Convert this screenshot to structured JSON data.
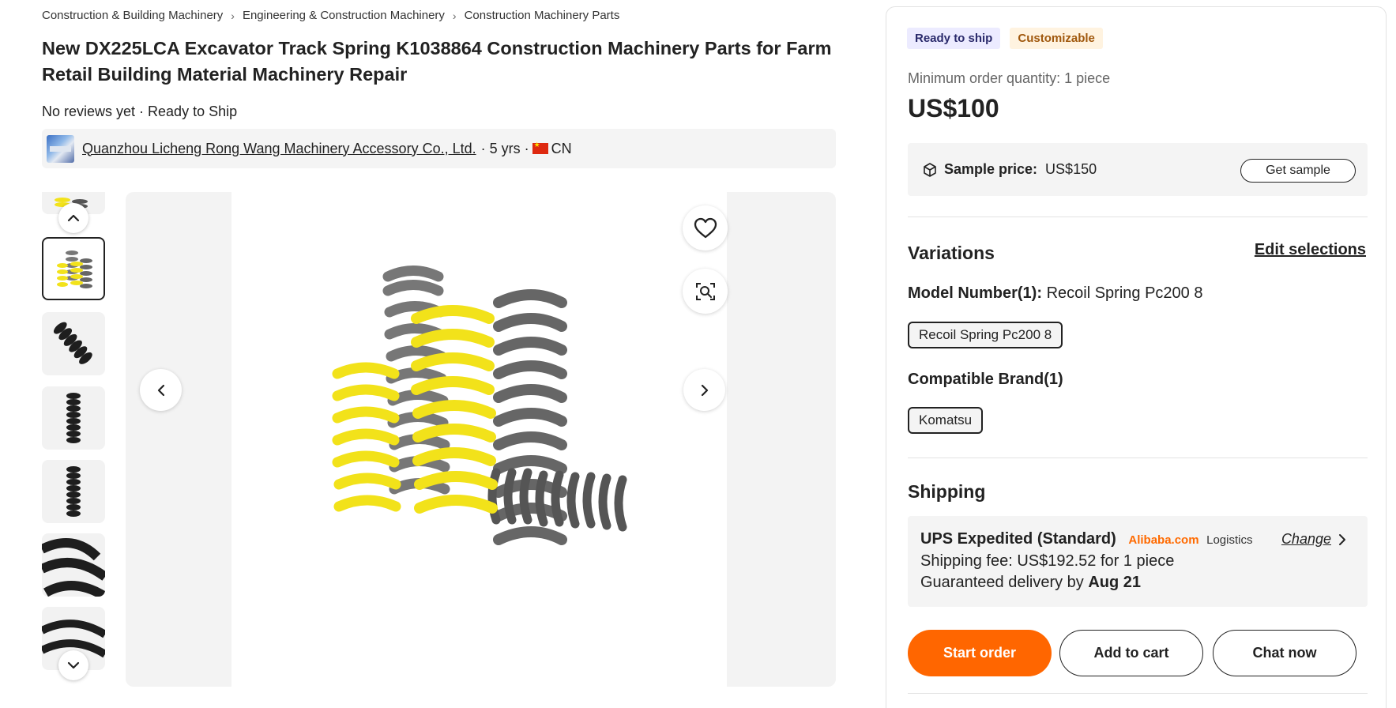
{
  "breadcrumb": [
    "Construction & Building Machinery",
    "Engineering & Construction Machinery",
    "Construction Machinery Parts"
  ],
  "product": {
    "title": "New DX225LCA Excavator Track Spring K1038864 Construction Machinery Parts for Farm Retail Building Material Machinery Repair",
    "review_line": "No reviews yet · Ready to Ship"
  },
  "supplier": {
    "name": "Quanzhou Licheng Rong Wang Machinery Accessory Co., Ltd.",
    "years": "· 5 yrs ·",
    "country": "CN"
  },
  "gallery": {
    "thumb_count": 6,
    "active_index": 1
  },
  "panel": {
    "badges": {
      "ready": "Ready to ship",
      "custom": "Customizable"
    },
    "moq": "Minimum order quantity: 1 piece",
    "price": "US$100",
    "sample": {
      "label": "Sample price:",
      "value": "US$150",
      "button": "Get sample"
    },
    "variations": {
      "title": "Variations",
      "edit": "Edit selections",
      "model_label": "Model Number(1):",
      "model_value": "Recoil Spring Pc200 8",
      "model_chip": "Recoil Spring Pc200 8",
      "brand_label": "Compatible Brand(1)",
      "brand_chip": "Komatsu"
    },
    "shipping": {
      "title": "Shipping",
      "method": "UPS Expedited (Standard)",
      "logo": "Alibaba.com",
      "logistics": "Logistics",
      "change": "Change",
      "fee": "Shipping fee: US$192.52 for 1 piece",
      "delivery_prefix": "Guaranteed delivery by",
      "delivery_date": "Aug 21"
    },
    "actions": {
      "start": "Start order",
      "cart": "Add to cart",
      "chat": "Chat now"
    }
  },
  "colors": {
    "accent": "#ff6600",
    "spring_yellow": "#f2e21a",
    "spring_gray": "#6b6b6b",
    "spring_black": "#1e1e1e"
  }
}
